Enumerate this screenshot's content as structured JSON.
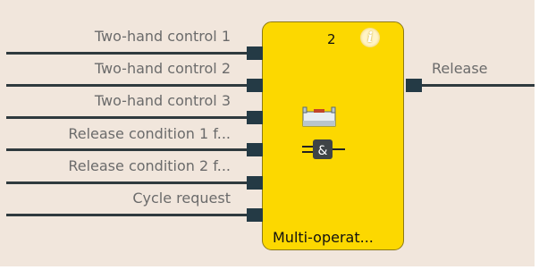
{
  "inputs": [
    {
      "label": "Two-hand control 1"
    },
    {
      "label": "Two-hand control 2"
    },
    {
      "label": "Two-hand control 3"
    },
    {
      "label": "Release condition 1 f..."
    },
    {
      "label": "Release condition 2 f..."
    },
    {
      "label": "Cycle request"
    }
  ],
  "outputs": [
    {
      "label": "Release"
    }
  ],
  "block": {
    "number": "2",
    "name": "Multi-operat...",
    "info_icon_glyph": "i",
    "icon_names": [
      "two-hand-station-icon",
      "and-gate-icon"
    ],
    "and_gate_symbol": "&"
  },
  "colors": {
    "canvas": "#f1e6dc",
    "block_fill": "#fcd800",
    "port": "#243a45",
    "wire": "#2f3a3e",
    "label_text": "#6b6b6b"
  }
}
